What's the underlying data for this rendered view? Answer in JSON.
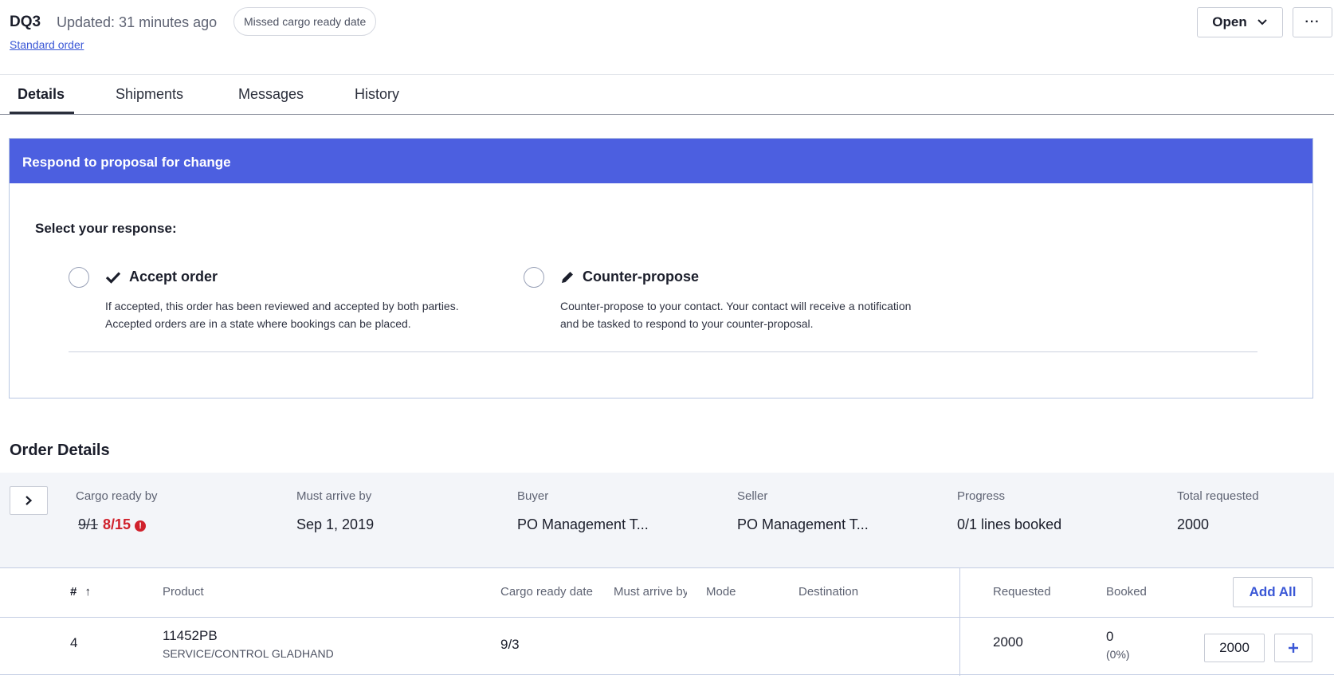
{
  "header": {
    "order_id": "DQ3",
    "updated": "Updated: 31 minutes ago",
    "status_pill": "Missed cargo ready date",
    "order_type": "Standard order",
    "status_button": "Open",
    "more_button": "···"
  },
  "tabs": [
    {
      "label": "Details",
      "active": true
    },
    {
      "label": "Shipments",
      "active": false
    },
    {
      "label": "Messages",
      "active": false
    },
    {
      "label": "History",
      "active": false
    }
  ],
  "proposal": {
    "title": "Respond to proposal for change",
    "select_label": "Select your response:",
    "options": [
      {
        "title": "Accept order",
        "icon": "checkmark-icon",
        "desc_line1": "If accepted, this order has been reviewed and accepted by both parties.",
        "desc_line2": "Accepted orders are in a state where bookings can be placed."
      },
      {
        "title": "Counter-propose",
        "icon": "pencil-icon",
        "desc_line1": "Counter-propose to your contact. Your contact will receive a notification",
        "desc_line2": "and be tasked to respond to your counter-proposal."
      }
    ]
  },
  "order_details": {
    "title": "Order Details",
    "summary": {
      "cargo_ready_label": "Cargo ready by",
      "cargo_ready_old": "9/1",
      "cargo_ready_new": "8/15",
      "must_arrive_label": "Must arrive by",
      "must_arrive_value": "Sep 1, 2019",
      "buyer_label": "Buyer",
      "buyer_value": "PO Management T...",
      "seller_label": "Seller",
      "seller_value": "PO Management T...",
      "progress_label": "Progress",
      "progress_value": "0/1 lines booked",
      "total_label": "Total requested",
      "total_value": "2000"
    },
    "table": {
      "headers": {
        "num": "#",
        "product": "Product",
        "cargo_ready": "Cargo ready date",
        "must_arrive": "Must arrive by",
        "mode": "Mode",
        "destination": "Destination",
        "requested": "Requested",
        "booked": "Booked"
      },
      "add_all": "Add All",
      "rows": [
        {
          "num": "4",
          "product_code": "11452PB",
          "product_desc": "SERVICE/CONTROL GLADHAND",
          "cargo_ready": "9/3",
          "requested": "2000",
          "booked": "0",
          "booked_pct": "(0%)",
          "qty": "2000"
        }
      ]
    }
  },
  "colors": {
    "accent": "#4c5fe0",
    "link": "#3a57d6",
    "alert": "#d0212c"
  }
}
